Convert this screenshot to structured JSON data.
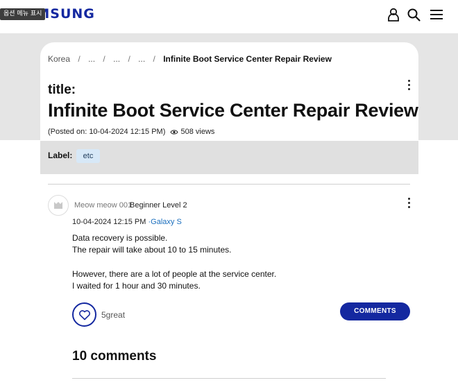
{
  "header": {
    "tooltip": "옵션 메뉴 표시",
    "logo": "SAMSUNG",
    "icons": [
      "user-icon",
      "search-icon",
      "hamburger-menu-icon"
    ],
    "brand_color": "#1428a0"
  },
  "breadcrumb": {
    "items": [
      "Korea",
      "...",
      "...",
      "..."
    ],
    "current": "Infinite Boot Service Center Repair Review",
    "separator": "/"
  },
  "post": {
    "title_prefix": "title:",
    "title": "Infinite Boot Service Center Repair Review",
    "posted_on": "(Posted on: 10-04-2024 12:15 PM)",
    "views": "508 views",
    "label_title": "Label:",
    "label_tag": "etc"
  },
  "message": {
    "author": "Meow meow 001",
    "rank": "Beginner Level 2",
    "date": "10-04-2024 12:15 PM",
    "product": "·Galaxy S",
    "lines": [
      "Data recovery is possible.",
      "The repair will take about 10 to 15 minutes.",
      "",
      "However, there are a lot of people at the service center.",
      "I waited for 1 hour and 30 minutes."
    ],
    "likes": "5great",
    "comments_button": "COMMENTS"
  },
  "comments_section": {
    "heading": "10 comments"
  }
}
